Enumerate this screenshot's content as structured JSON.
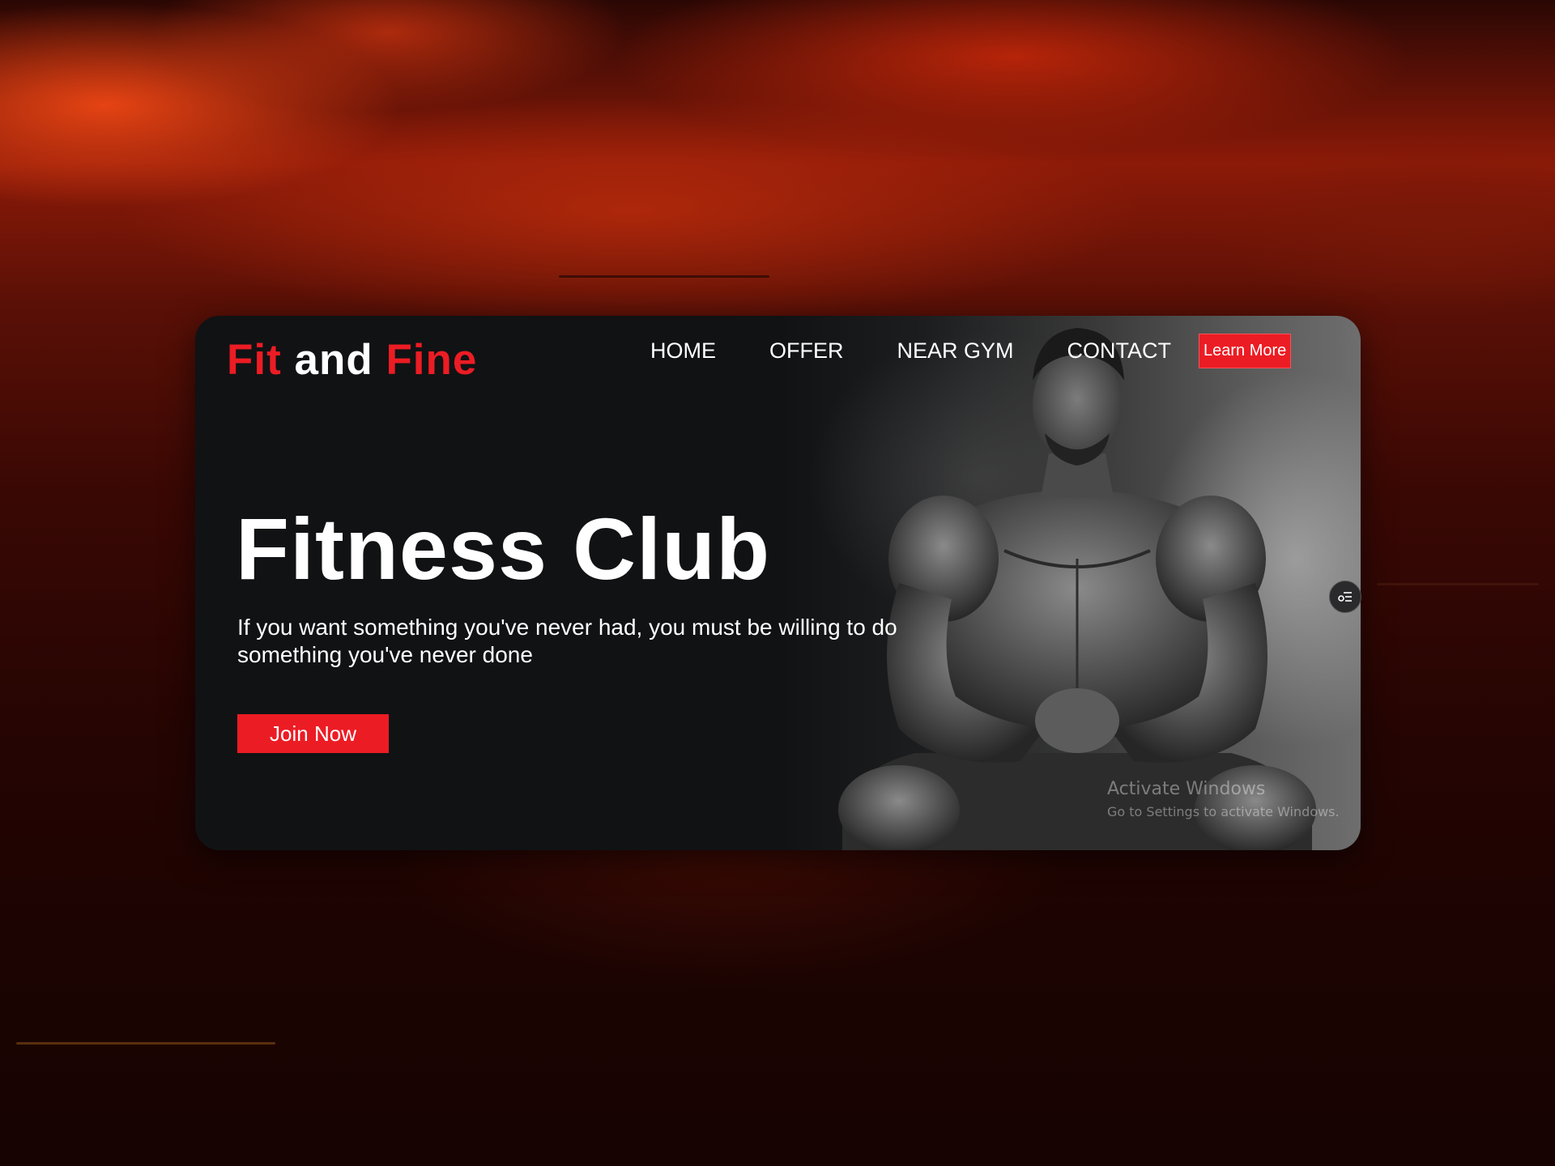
{
  "brand": {
    "part1": "Fit",
    "part2": " and ",
    "part3": "Fine",
    "accent_color": "#ec1c24"
  },
  "nav": {
    "items": [
      {
        "label": "HOME"
      },
      {
        "label": "OFFER"
      },
      {
        "label": "NEAR GYM"
      },
      {
        "label": "CONTACT"
      }
    ],
    "cta_label": "Learn More"
  },
  "hero": {
    "title": "Fitness Club",
    "subtitle": "If you want something you've never had, you must be willing to do something you've never done",
    "cta_label": "Join Now",
    "photo_icon": "muscular-man-photo"
  },
  "floating_button": {
    "icon": "settings-list-icon"
  },
  "watermark": {
    "line1": "Activate Windows",
    "line2": "Go to Settings to activate Windows."
  }
}
